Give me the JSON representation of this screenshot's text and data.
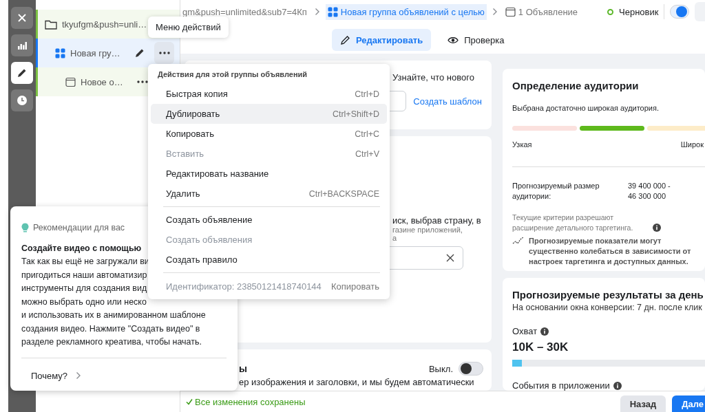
{
  "rail": [
    {
      "kind": "close",
      "selected": false
    },
    {
      "kind": "chart",
      "selected": false
    },
    {
      "kind": "edit",
      "selected": true
    },
    {
      "kind": "history",
      "selected": false
    }
  ],
  "tree": [
    {
      "kind": "campaign",
      "label": "tkyufgm&push=unli…",
      "selected": false,
      "children": [
        {
          "kind": "adset",
          "label": "Новая гру…",
          "selected": true,
          "children": [
            {
              "kind": "ad",
              "label": "Новое о…",
              "selected": false
            }
          ]
        }
      ]
    }
  ],
  "tooltip": "Меню действий",
  "breadcrumb": [
    {
      "label": "gm&push=unlimited&sub7=4Кп",
      "selected": false
    },
    {
      "kind": "adset",
      "label": "Новая группа объявлений с целью",
      "selected": true
    },
    {
      "kind": "ad",
      "label": "1 Объявление",
      "selected": false
    }
  ],
  "status": {
    "label": "Черновик",
    "on": true
  },
  "tabs": [
    {
      "kind": "edit",
      "label": "Редактировать",
      "selected": true
    },
    {
      "kind": "preview",
      "label": "Проверка",
      "selected": false
    }
  ],
  "left_cards": [
    {
      "kind": "template",
      "text": "Узнайте, что нового",
      "link": "Создать шаблон"
    },
    {
      "kind": "location",
      "text": "иск, выбрав страну, в",
      "hints": [
        "газине приложений,",
        "а"
      ]
    },
    {
      "kind": "switch",
      "title": "ы",
      "toggle_label": "Выкл.",
      "on": false,
      "text": "ер изображения и заголовки, и мы будем автоматически"
    }
  ],
  "audience": {
    "title": "Определение аудитории",
    "subtitle": "Выбрана достаточно широкая аудитория.",
    "segments": [
      {
        "color": "#fbe1de"
      },
      {
        "color": "#5eb91c"
      },
      {
        "color": "#fdecc8"
      }
    ],
    "low_label": "Узкая",
    "high_label": "Широк",
    "size_label": "Прогнозируемый размер аудитории:",
    "size_value": "39 400 000 - 46 300 000",
    "note": "Текущие критерии разрешают расширение детального таргетинга.",
    "warning": "Прогнозируемые показатели могут существенно колебаться в зависимости от настроек таргетинга и доступных данных."
  },
  "results": {
    "title": "Прогнозируемые результаты за день",
    "subtitle": "На основании окна конверсии: 7 дн. после клик",
    "metrics": [
      {
        "label": "Охват",
        "value": "10K – 30K",
        "level": 0.05
      },
      {
        "label": "События в приложении"
      }
    ]
  },
  "menu": {
    "header": "Действия для этой группы объявлений",
    "groups": [
      [
        {
          "label": "Быстрая копия",
          "shortcut": "Ctrl+D",
          "disabled": false,
          "selected": false
        },
        {
          "label": "Дублировать",
          "shortcut": "Ctrl+Shift+D",
          "disabled": false,
          "selected": true
        },
        {
          "label": "Копировать",
          "shortcut": "Ctrl+C",
          "disabled": false,
          "selected": false
        },
        {
          "label": "Вставить",
          "shortcut": "Ctrl+V",
          "disabled": true,
          "selected": false
        },
        {
          "label": "Редактировать название",
          "disabled": false,
          "selected": false
        },
        {
          "label": "Удалить",
          "shortcut": "Ctrl+BACKSPACE",
          "disabled": false,
          "selected": false
        }
      ],
      [
        {
          "label": "Создать объявление",
          "disabled": false,
          "selected": false
        },
        {
          "label": "Создать объявления",
          "disabled": true,
          "selected": false
        },
        {
          "label": "Создать правило",
          "disabled": false,
          "selected": false
        }
      ]
    ],
    "footer": {
      "label": "Идентификатор: 23850121418740144",
      "action": "Копировать"
    }
  },
  "recommendation": {
    "title": "Рекомендации для вас",
    "heading": "Создайте видео с помощью",
    "lines": [
      "Так как вы ещё не загружали ви",
      "пригодиться наши автоматизир",
      "инструменты для создания вид",
      "можно выбрать одно или неско",
      "и использовать их в анимированном шаблоне",
      "создания видео. Нажмите \"Создать видео\" в",
      "разделе рекламного креатива, чтобы начать."
    ],
    "link": "Почему?"
  },
  "footer": {
    "saved": "Все изменения сохранены",
    "buttons": [
      {
        "kind": "secondary",
        "label": "Назад"
      },
      {
        "kind": "primary",
        "label": "Дале"
      }
    ]
  }
}
